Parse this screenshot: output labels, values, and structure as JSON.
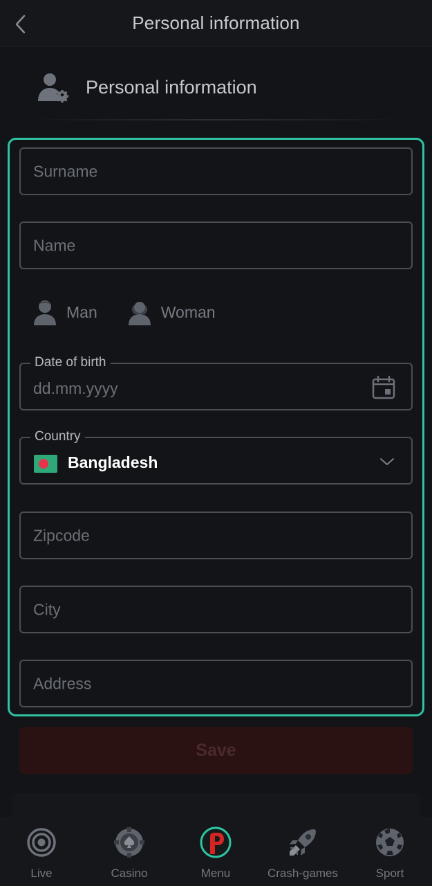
{
  "header": {
    "title": "Personal information"
  },
  "section": {
    "title": "Personal information"
  },
  "form": {
    "surname_placeholder": "Surname",
    "name_placeholder": "Name",
    "gender": {
      "man": "Man",
      "woman": "Woman"
    },
    "dob": {
      "label": "Date of birth",
      "placeholder": "dd.mm.yyyy"
    },
    "country": {
      "label": "Country",
      "value": "Bangladesh"
    },
    "zipcode_placeholder": "Zipcode",
    "city_placeholder": "City",
    "address_placeholder": "Address",
    "save_label": "Save"
  },
  "nav": {
    "items": [
      {
        "label": "Live",
        "icon": "live-icon"
      },
      {
        "label": "Casino",
        "icon": "casino-chip-icon"
      },
      {
        "label": "Menu",
        "icon": "menu-logo-icon"
      },
      {
        "label": "Crash-games",
        "icon": "rocket-icon"
      },
      {
        "label": "Sport",
        "icon": "soccer-ball-icon"
      }
    ]
  },
  "colors": {
    "background": "#121418",
    "accent_frame": "#2fc3a3",
    "save_bg": "#2a1212",
    "flag_green": "#2fa877",
    "flag_red": "#e8324a"
  }
}
